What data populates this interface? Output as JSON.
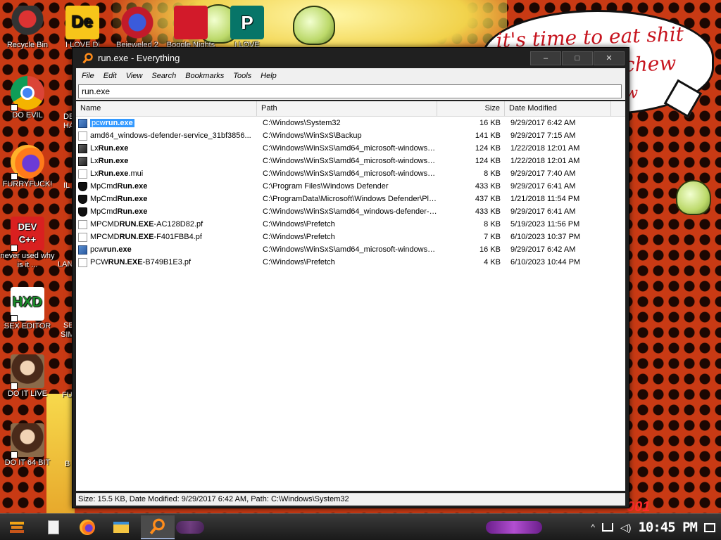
{
  "desktop": {
    "speech_bubble": [
      "it's time to eat shit",
      "chew",
      "w"
    ],
    "art_text": "001",
    "icons": [
      {
        "label": "Recycle Bin"
      },
      {
        "label": "DO EVIL"
      },
      {
        "label": "FURRYFUCK!"
      },
      {
        "label": "never used why is it ..."
      },
      {
        "label": "SEX EDITOR"
      },
      {
        "label": "DO IT LIVE"
      },
      {
        "label": "DO IT 64 BIT"
      }
    ],
    "icons_col2": [
      {
        "label": "I LOVE DET"
      },
      {
        "label": "Bejeweled 2"
      },
      {
        "label": "Boggle Nights"
      },
      {
        "label": "I LOVE"
      }
    ],
    "partial_labels": [
      "DE",
      "HA",
      "IL",
      "LAN",
      "SE",
      "SIM",
      "FU",
      "B"
    ]
  },
  "window": {
    "title": "run.exe - Everything",
    "buttons": {
      "minimize": "–",
      "maximize": "□",
      "close": "✕"
    },
    "menu": [
      "File",
      "Edit",
      "View",
      "Search",
      "Bookmarks",
      "Tools",
      "Help"
    ],
    "search_value": "run.exe",
    "columns": {
      "name": "Name",
      "path": "Path",
      "size": "Size",
      "date": "Date Modified"
    },
    "rows": [
      {
        "pre": "pcw",
        "bold": "run.exe",
        "post": "",
        "path": "C:\\Windows\\System32",
        "size": "16 KB",
        "date": "9/29/2017 6:42 AM",
        "icon": "exe-blue",
        "selected": true
      },
      {
        "pre": "amd64_windows-defender-service_31bf3856...",
        "bold": "",
        "post": "",
        "path": "C:\\Windows\\WinSxS\\Backup",
        "size": "141 KB",
        "date": "9/29/2017 7:15 AM",
        "icon": "doc"
      },
      {
        "pre": "Lx",
        "bold": "Run.exe",
        "post": "",
        "path": "C:\\Windows\\WinSxS\\amd64_microsoft-windows-l...",
        "size": "124 KB",
        "date": "1/22/2018 12:01 AM",
        "icon": "exe-dark"
      },
      {
        "pre": "Lx",
        "bold": "Run.exe",
        "post": "",
        "path": "C:\\Windows\\WinSxS\\amd64_microsoft-windows-l...",
        "size": "124 KB",
        "date": "1/22/2018 12:01 AM",
        "icon": "exe-dark"
      },
      {
        "pre": "Lx",
        "bold": "Run.exe",
        "post": ".mui",
        "path": "C:\\Windows\\WinSxS\\amd64_microsoft-windows-l....",
        "size": "8 KB",
        "date": "9/29/2017 7:40 AM",
        "icon": "doc"
      },
      {
        "pre": "MpCmd",
        "bold": "Run.exe",
        "post": "",
        "path": "C:\\Program Files\\Windows Defender",
        "size": "433 KB",
        "date": "9/29/2017 6:41 AM",
        "icon": "shield"
      },
      {
        "pre": "MpCmd",
        "bold": "Run.exe",
        "post": "",
        "path": "C:\\ProgramData\\Microsoft\\Windows Defender\\Pla...",
        "size": "437 KB",
        "date": "1/21/2018 11:54 PM",
        "icon": "shield"
      },
      {
        "pre": "MpCmd",
        "bold": "Run.exe",
        "post": "",
        "path": "C:\\Windows\\WinSxS\\amd64_windows-defender-s...",
        "size": "433 KB",
        "date": "9/29/2017 6:41 AM",
        "icon": "shield"
      },
      {
        "pre": "MPCMD",
        "bold": "RUN.EXE",
        "post": "-AC128D82.pf",
        "path": "C:\\Windows\\Prefetch",
        "size": "8 KB",
        "date": "5/19/2023 11:56 PM",
        "icon": "doc"
      },
      {
        "pre": "MPCMD",
        "bold": "RUN.EXE",
        "post": "-F401FBB4.pf",
        "path": "C:\\Windows\\Prefetch",
        "size": "7 KB",
        "date": "6/10/2023 10:37 PM",
        "icon": "doc"
      },
      {
        "pre": "pcw",
        "bold": "run.exe",
        "post": "",
        "path": "C:\\Windows\\WinSxS\\amd64_microsoft-windows-p...",
        "size": "16 KB",
        "date": "9/29/2017 6:42 AM",
        "icon": "exe-blue"
      },
      {
        "pre": "PCW",
        "bold": "RUN.EXE",
        "post": "-B749B1E3.pf",
        "path": "C:\\Windows\\Prefetch",
        "size": "4 KB",
        "date": "6/10/2023 10:44 PM",
        "icon": "doc"
      }
    ],
    "status": "Size: 15.5 KB, Date Modified: 9/29/2017 6:42 AM, Path: C:\\Windows\\System32"
  },
  "taskbar": {
    "clock": "10:45 PM"
  }
}
